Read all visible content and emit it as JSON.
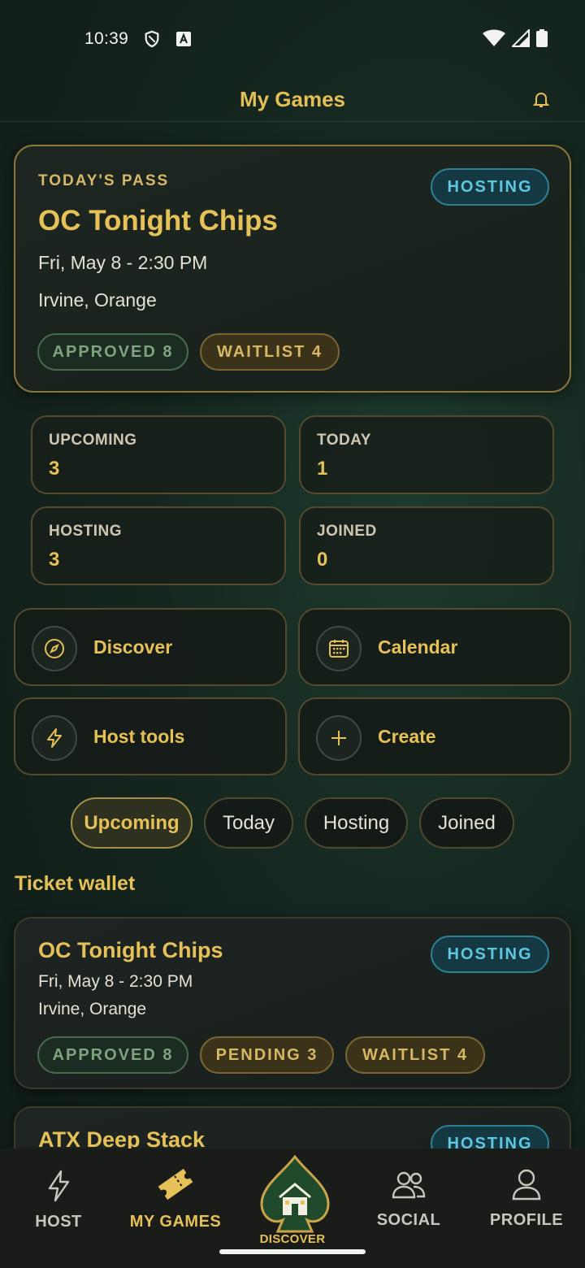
{
  "status_bar": {
    "time": "10:39"
  },
  "header": {
    "title": "My Games"
  },
  "pass": {
    "eyebrow": "TODAY'S PASS",
    "title": "OC Tonight Chips",
    "date": "Fri, May 8 - 2:30 PM",
    "location": "Irvine, Orange",
    "role_badge": "HOSTING",
    "approved": "APPROVED 8",
    "waitlist": "WAITLIST 4"
  },
  "stats": [
    {
      "label": "UPCOMING",
      "value": "3"
    },
    {
      "label": "TODAY",
      "value": "1"
    },
    {
      "label": "HOSTING",
      "value": "3"
    },
    {
      "label": "JOINED",
      "value": "0"
    }
  ],
  "actions": [
    {
      "label": "Discover",
      "icon": "compass-icon"
    },
    {
      "label": "Calendar",
      "icon": "calendar-icon"
    },
    {
      "label": "Host tools",
      "icon": "lightning-icon"
    },
    {
      "label": "Create",
      "icon": "plus-icon"
    }
  ],
  "filters": [
    {
      "label": "Upcoming",
      "active": true
    },
    {
      "label": "Today",
      "active": false
    },
    {
      "label": "Hosting",
      "active": false
    },
    {
      "label": "Joined",
      "active": false
    }
  ],
  "wallet": {
    "title": "Ticket wallet",
    "tickets": [
      {
        "title": "OC Tonight Chips",
        "date": "Fri, May 8 - 2:30 PM",
        "location": "Irvine, Orange",
        "role_badge": "HOSTING",
        "approved": "APPROVED 8",
        "pending": "PENDING 3",
        "waitlist": "WAITLIST 4"
      },
      {
        "title": "ATX Deep Stack",
        "role_badge": "HOSTING"
      }
    ]
  },
  "bottom_nav": {
    "host": "HOST",
    "my_games": "MY GAMES",
    "discover": "DISCOVER",
    "social": "SOCIAL",
    "profile": "PROFILE"
  },
  "colors": {
    "accent_gold": "#e6c158",
    "hosting_blue": "#5fc7e0",
    "approved_green": "#7da37f"
  }
}
